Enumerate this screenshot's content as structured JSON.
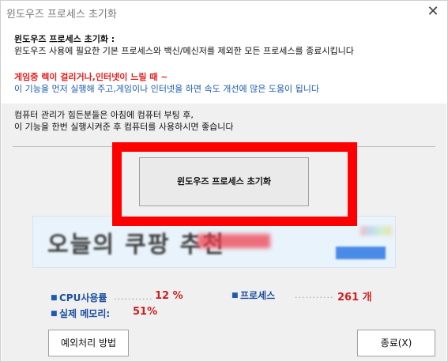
{
  "window": {
    "title": "윈도우즈 프로세스 초기화",
    "close_glyph": "✕"
  },
  "intro": {
    "heading": "윈도우즈 프로세스 초기화 :",
    "description": "윈도우즈 사용에 필요한 기본 프로세스와 백신/메신저를 제외한 모든 프로세스를 종료시킵니다",
    "warning": "게임중 렉이 걸리거나,인터넷이 느릴 때 ~",
    "advice": "이 기능을 먼저 실행해 주고,게임이나 인터넷을 하면 속도 개선에 많은 도움이 됩니다",
    "tip_line1": "컴퓨터 관리가 힘든분들은 아침에 컴퓨터 부팅 후,",
    "tip_line2": "이 기능을 한번 실행시켜준 후 컴퓨터를 사용하시면 좋습니다"
  },
  "main_button": {
    "label": "윈도우즈 프로세스 초기화"
  },
  "stats": {
    "bullet": "■",
    "cpu_label": "CPU사용률",
    "cpu_dots": "...........",
    "cpu_value": "12 %",
    "process_label": "프로세스",
    "process_dots": "...........",
    "process_value": "261 개",
    "memory_label": "실제 메모리:",
    "memory_value": "51%"
  },
  "footer": {
    "exception_button": "예외처리 방법",
    "exit_button": "종료(X)"
  },
  "colors": {
    "accent_red": "#ff0000",
    "label_blue": "#1e4fa0",
    "value_red": "#cc2222"
  }
}
